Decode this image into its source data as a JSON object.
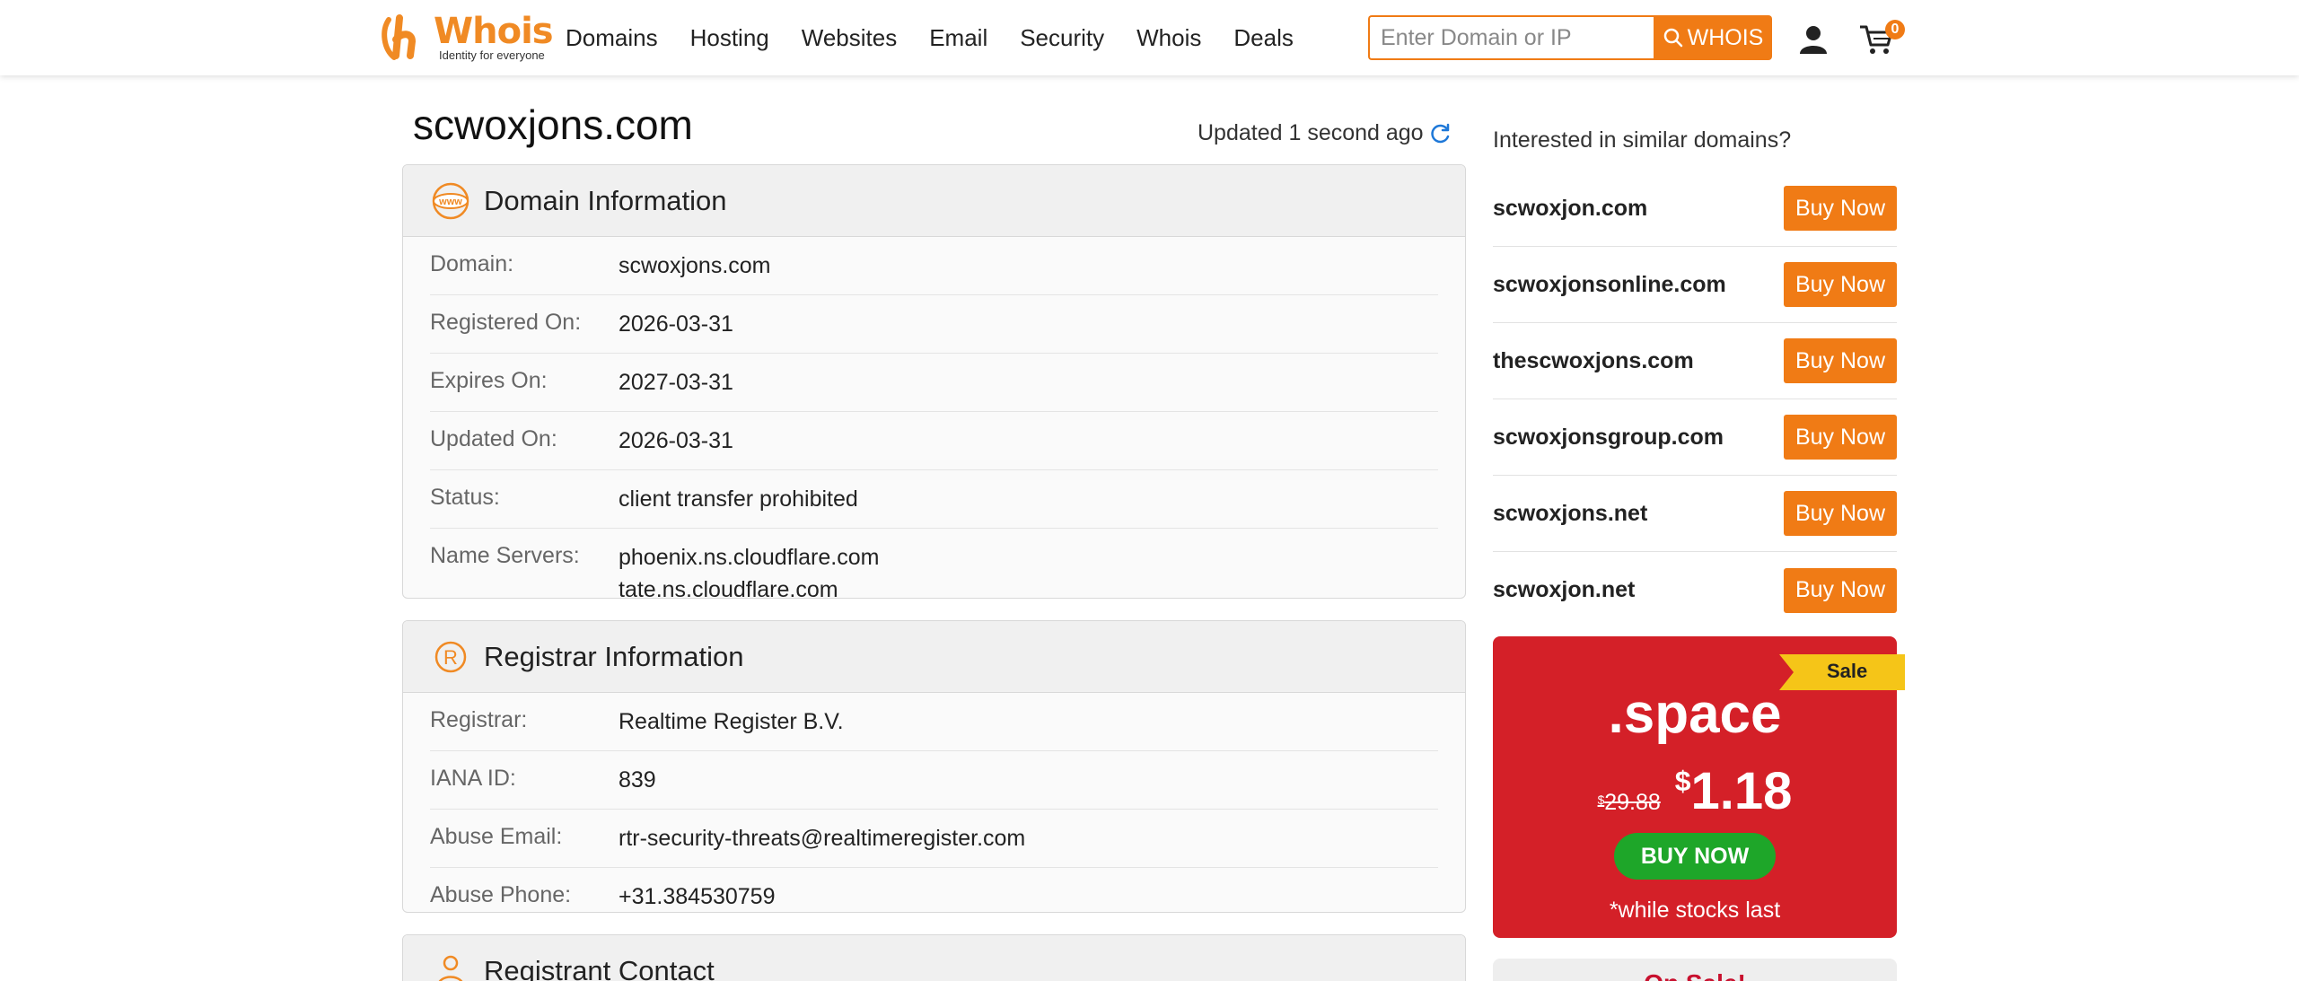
{
  "header": {
    "logo_text": "Whois",
    "logo_tagline": "Identity for everyone",
    "nav": [
      "Domains",
      "Hosting",
      "Websites",
      "Email",
      "Security",
      "Whois",
      "Deals"
    ],
    "search_placeholder": "Enter Domain or IP",
    "search_button": "WHOIS",
    "cart_count": "0",
    "accent_color": "#f07b15"
  },
  "main": {
    "title": "scwoxjons.com",
    "updated": "Updated 1 second ago"
  },
  "domain_info": {
    "title": "Domain Information",
    "icon": "www-icon",
    "rows": [
      {
        "label": "Domain:",
        "value": "scwoxjons.com"
      },
      {
        "label": "Registered On:",
        "value": "2026-03-31"
      },
      {
        "label": "Expires On:",
        "value": "2027-03-31"
      },
      {
        "label": "Updated On:",
        "value": "2026-03-31"
      },
      {
        "label": "Status:",
        "value": "client transfer prohibited"
      },
      {
        "label": "Name Servers:",
        "value": "phoenix.ns.cloudflare.com",
        "value2": "tate.ns.cloudflare.com"
      }
    ]
  },
  "registrar_info": {
    "title": "Registrar Information",
    "icon": "registered-icon",
    "rows": [
      {
        "label": "Registrar:",
        "value": "Realtime Register B.V."
      },
      {
        "label": "IANA ID:",
        "value": "839"
      },
      {
        "label": "Abuse Email:",
        "value": "rtr-security-threats@realtimeregister.com"
      },
      {
        "label": "Abuse Phone:",
        "value": "+31.384530759"
      }
    ]
  },
  "registrant_contact": {
    "title": "Registrant Contact",
    "icon": "person-icon"
  },
  "sidebar": {
    "similar_heading": "Interested in similar domains?",
    "buy_label": "Buy Now",
    "similar": [
      "scwoxjon.com",
      "scwoxjonsonline.com",
      "thescwoxjons.com",
      "scwoxjonsgroup.com",
      "scwoxjons.net",
      "scwoxjon.net"
    ],
    "promo": {
      "ribbon": "Sale",
      "tld": ".space",
      "currency": "$",
      "old_price": "29.88",
      "new_price": "1.18",
      "button": "BUY NOW",
      "note": "*while stocks last",
      "bg_color": "#d42028",
      "button_color": "#1ea629"
    },
    "on_sale_heading": "On Sale!"
  }
}
